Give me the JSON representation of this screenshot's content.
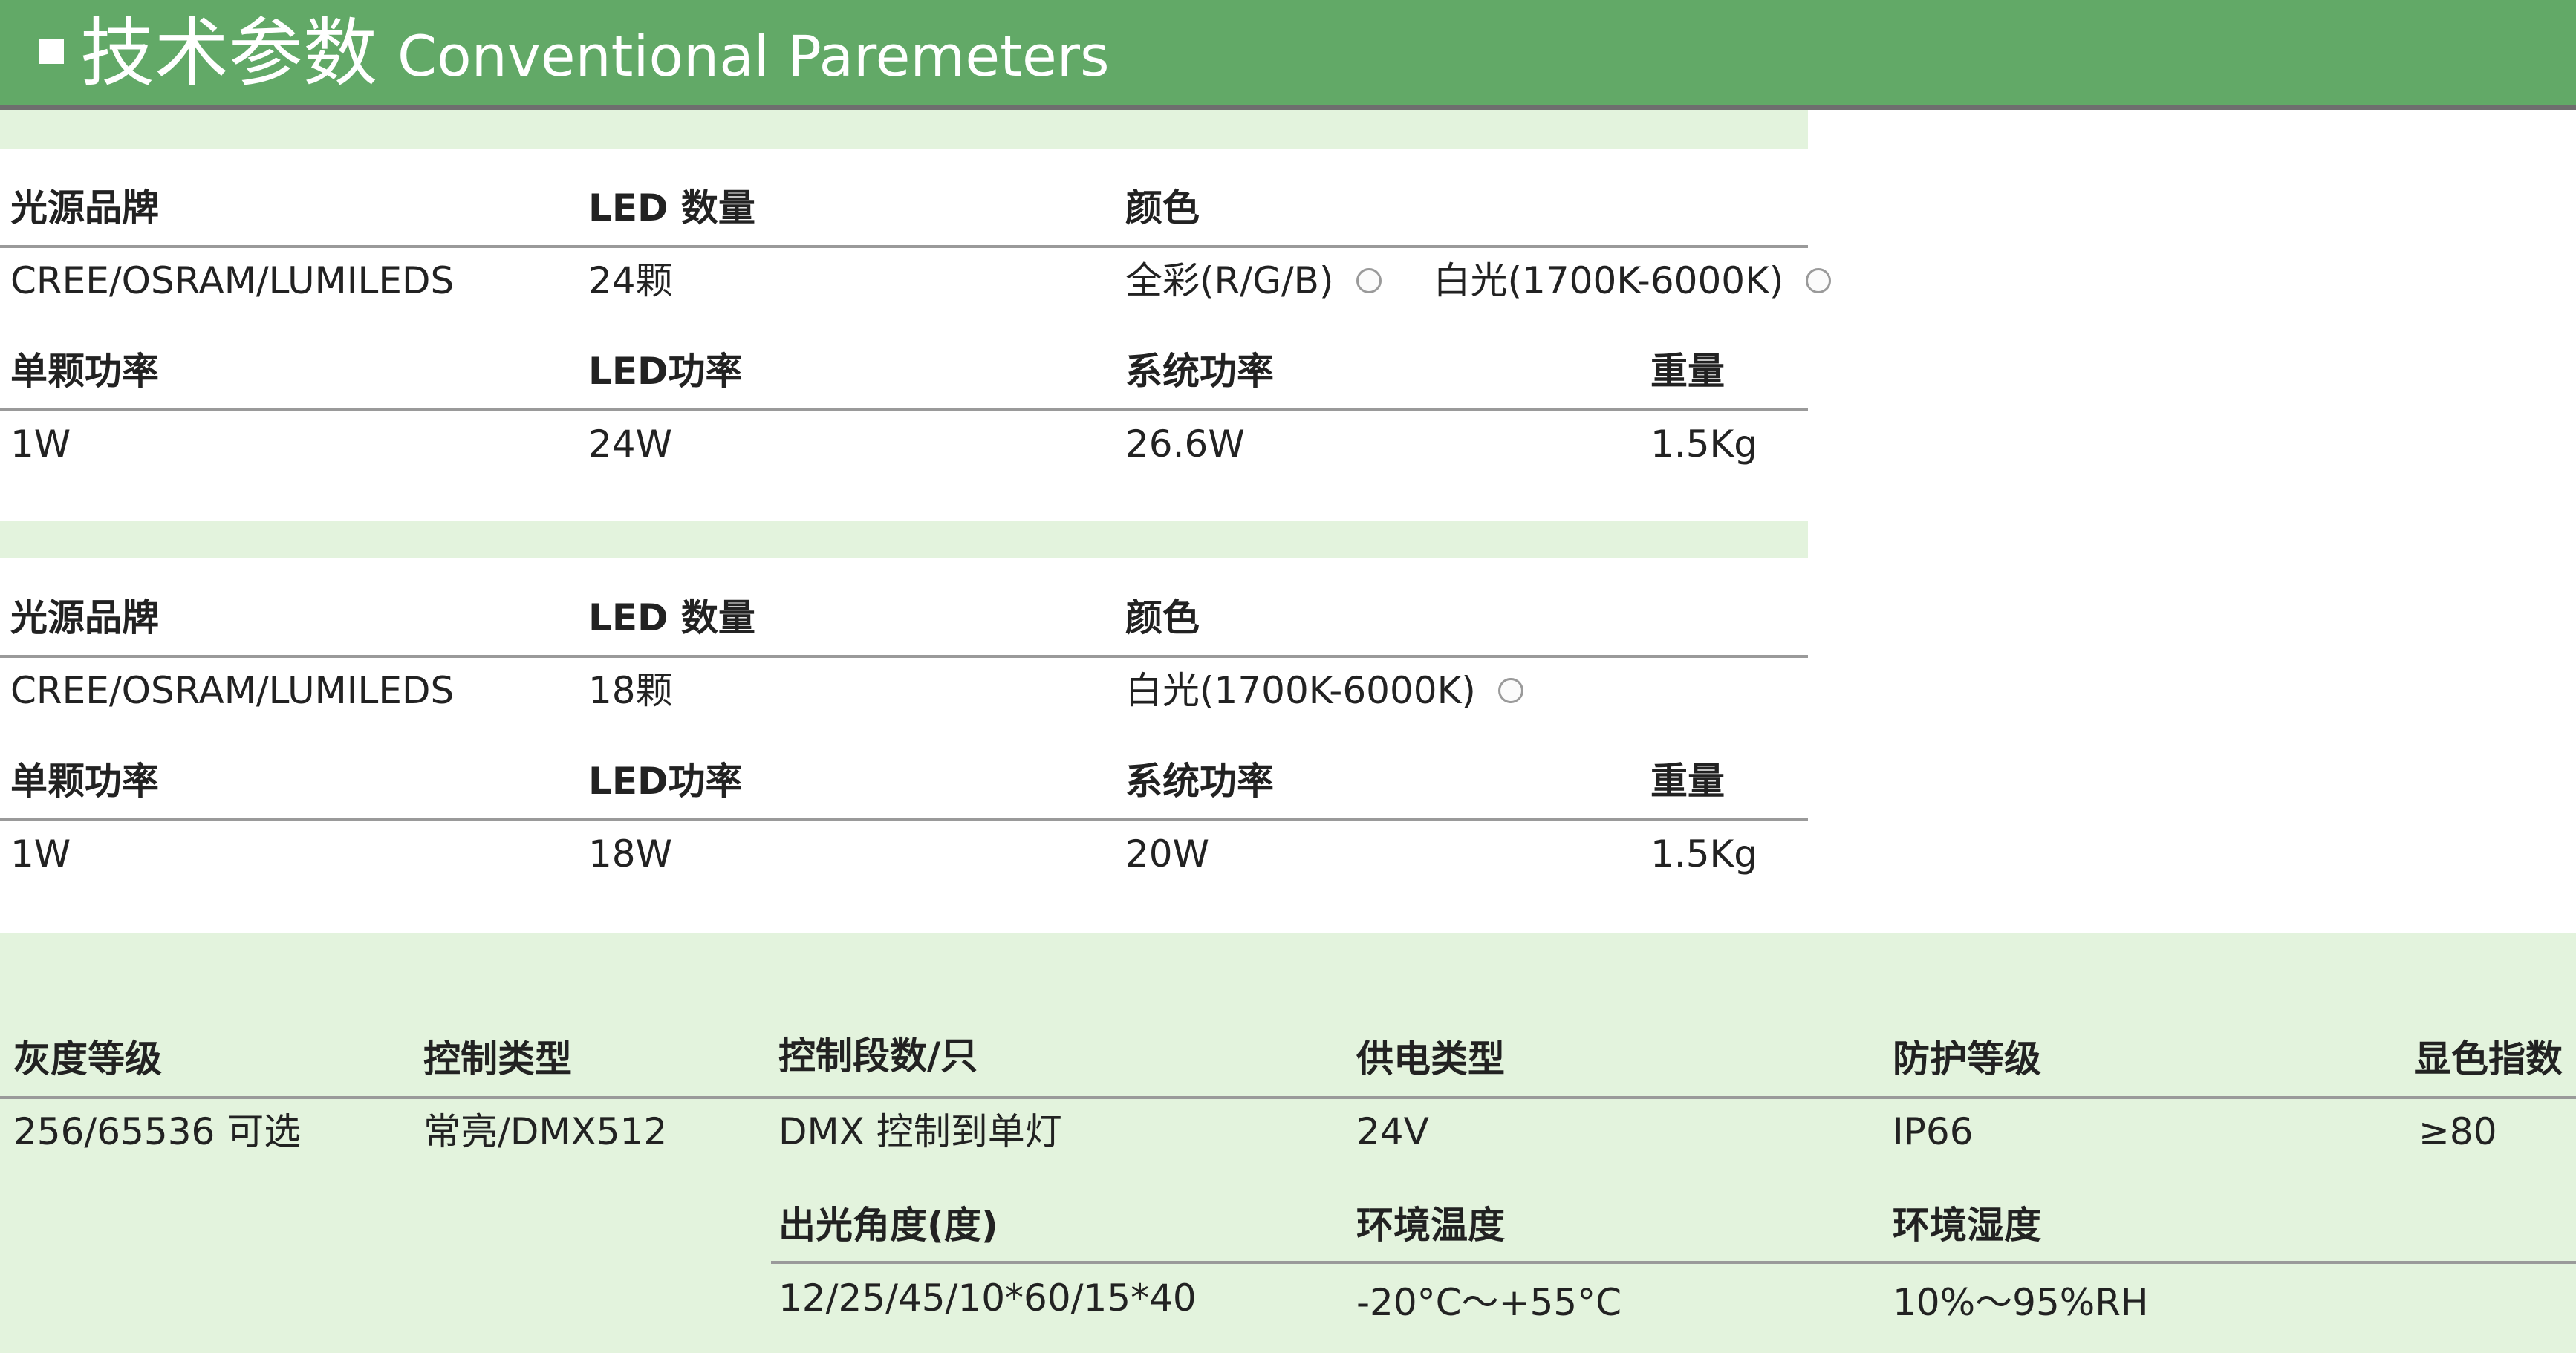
{
  "header": {
    "title_cn": "技术参数",
    "title_en": "Conventional Paremeters",
    "accent_color": "#62a967",
    "band_color": "#e3f3dd"
  },
  "spec1": {
    "h_brand": "光源品牌",
    "h_count": "LED 数量",
    "h_color": "颜色",
    "brand": "CREE/OSRAM/LUMILEDS",
    "count": "24颗",
    "color_options": [
      "全彩(R/G/B)",
      "白光(1700K-6000K)"
    ],
    "h_unit_power": "单颗功率",
    "h_led_power": "LED功率",
    "h_sys_power": "系统功率",
    "h_weight": "重量",
    "unit_power": "1W",
    "led_power": "24W",
    "sys_power": "26.6W",
    "weight": "1.5Kg"
  },
  "spec2": {
    "h_brand": "光源品牌",
    "h_count": "LED 数量",
    "h_color": "颜色",
    "brand": "CREE/OSRAM/LUMILEDS",
    "count": "18颗",
    "color_options": [
      "白光(1700K-6000K)"
    ],
    "h_unit_power": "单颗功率",
    "h_led_power": "LED功率",
    "h_sys_power": "系统功率",
    "h_weight": "重量",
    "unit_power": "1W",
    "led_power": "18W",
    "sys_power": "20W",
    "weight": "1.5Kg"
  },
  "common": {
    "h_gray": "灰度等级",
    "h_ctrl_type": "控制类型",
    "h_ctrl_seg": "控制段数/只",
    "h_supply": "供电类型",
    "h_ip": "防护等级",
    "h_cri": "显色指数",
    "gray": "256/65536 可选",
    "ctrl_type": "常亮/DMX512",
    "ctrl_seg": "DMX 控制到单灯",
    "supply": "24V",
    "ip": "IP66",
    "cri": "≥80",
    "h_beam": "出光角度(度)",
    "h_temp": "环境温度",
    "h_humid": "环境湿度",
    "beam": "12/25/45/10*60/15*40",
    "temp": "-20°C～+55°C",
    "humid": "10%～95%RH"
  }
}
